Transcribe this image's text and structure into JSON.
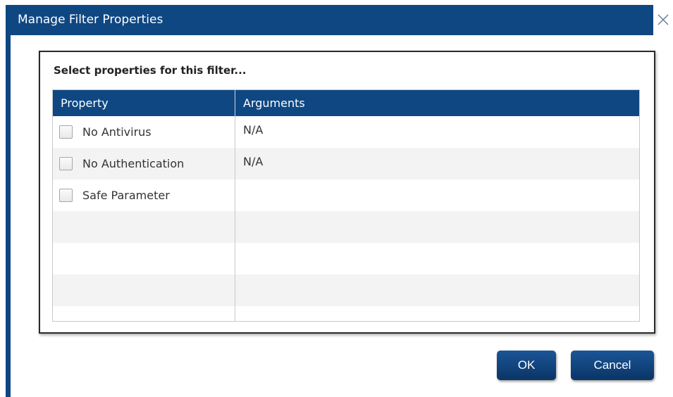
{
  "window": {
    "title": "Manage Filter Properties",
    "close_icon": "close-icon",
    "accent_color": "#0f4782"
  },
  "panel": {
    "caption": "Select properties for this filter..."
  },
  "grid": {
    "columns": [
      "Property",
      "Arguments"
    ],
    "rows": [
      {
        "property": "No Antivirus",
        "arguments": "N/A",
        "checked": false
      },
      {
        "property": "No Authentication",
        "arguments": "N/A",
        "checked": false
      },
      {
        "property": "Safe Parameter",
        "arguments": "",
        "checked": false
      }
    ]
  },
  "buttons": {
    "ok_label": "OK",
    "cancel_label": "Cancel"
  }
}
